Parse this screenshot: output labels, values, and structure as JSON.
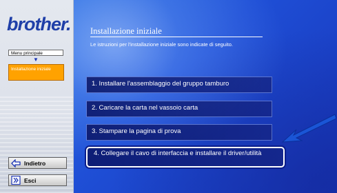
{
  "brand": "brother.",
  "sidebar": {
    "menu_label": "Menu principale",
    "nav_arrow": "▼",
    "current_label": "Installazione iniziale",
    "back_label": "Indietro",
    "exit_label": "Esci"
  },
  "main": {
    "title": "Installazione iniziale",
    "subtitle": "Le istruzioni per l'installazione iniziale sono indicate di seguito.",
    "options": [
      "1. Installare l'assemblaggio del gruppo tamburo",
      "2. Caricare la carta nel vassoio carta",
      "3. Stampare la pagina di prova",
      "4. Collegare il cavo di interfaccia e installare il driver/utilità"
    ]
  },
  "colors": {
    "panel_blue": "#1f4fd6",
    "nav_active": "#ffa200",
    "arrow": "#1a55d6"
  }
}
